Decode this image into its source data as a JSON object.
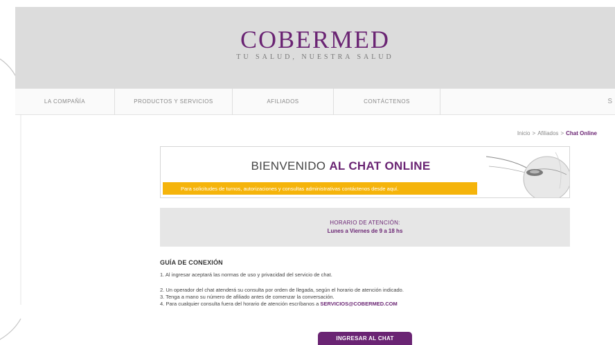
{
  "header": {
    "logo_name": "COBERMED",
    "logo_tagline": "TU SALUD, NUESTRA SALUD"
  },
  "nav": {
    "items": [
      "LA COMPAÑÍA",
      "PRODUCTOS Y SERVICIOS",
      "AFILIADOS",
      "CONTÁCTENOS"
    ],
    "right_glyph": "S"
  },
  "breadcrumb": {
    "items": [
      "Inicio",
      "Afiliados",
      "Chat Online"
    ],
    "separator": ">"
  },
  "welcome": {
    "title_prefix": "BIENVENIDO",
    "title_bold": "AL CHAT ONLINE",
    "bar_text": "Para solicitudes de turnos, autorizaciones y consultas administrativas contáctenos desde aquí."
  },
  "hours": {
    "title": "HORARIO DE ATENCIÓN:",
    "value": "Lunes a Viernes de 9 a 18 hs"
  },
  "guide": {
    "title": "GUÍA DE CONEXIÓN",
    "items": [
      "1. Al ingresar aceptará las normas de uso y privacidad del servicio de chat.",
      "2. Un operador del chat atenderá su consulta por orden de llegada, según el horario de atención indicado.",
      "3. Tenga a mano su número de afiliado antes de comenzar la conversación.",
      "4. Para cualquier consulta fuera del horario de atención escríbanos a"
    ],
    "link_text": "SERVICIOS@COBERMED.COM"
  },
  "chat_button": {
    "label": "INGRESAR AL CHAT"
  },
  "colors": {
    "brand_purple": "#6a2473",
    "accent_orange": "#f5b40b",
    "header_gray": "#dcdcdc"
  }
}
